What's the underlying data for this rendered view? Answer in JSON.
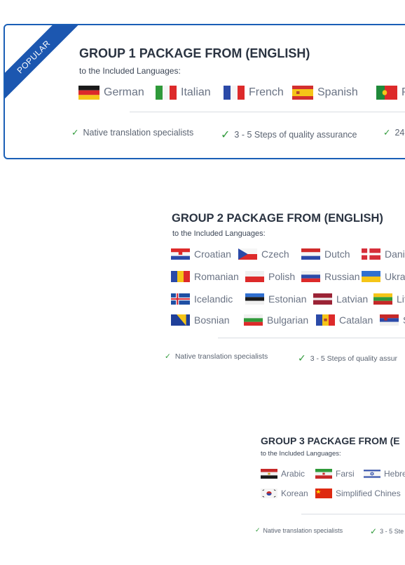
{
  "group1": {
    "badge": "POPULAR",
    "title": "GROUP 1 PACKAGE FROM (ENGLISH)",
    "subtitle": "to the Included Languages:",
    "languages": [
      "German",
      "Italian",
      "French",
      "Spanish",
      "P"
    ],
    "features": [
      "Native translation specialists",
      "3 - 5 Steps of quality assurance",
      "24"
    ]
  },
  "group2": {
    "title": "GROUP 2 PACKAGE FROM (ENGLISH)",
    "subtitle": "to the Included Languages:",
    "languages": [
      "Croatian",
      "Czech",
      "Dutch",
      "Dani",
      "Romanian",
      "Polish",
      "Russian",
      "Ukra",
      "Icelandic",
      "Estonian",
      "Latvian",
      "Lit",
      "Bosnian",
      "Bulgarian",
      "Catalan",
      "S"
    ],
    "features": [
      "Native translation specialists",
      "3 - 5 Steps of quality assur"
    ]
  },
  "group3": {
    "title": "GROUP 3 PACKAGE FROM (E",
    "subtitle": "to the Included Languages:",
    "languages": [
      "Arabic",
      "Farsi",
      "Hebre",
      "Korean",
      "Simplified Chines"
    ],
    "features": [
      "Native translation specialists",
      "3 - 5 Ste"
    ]
  },
  "colors": {
    "accent": "#1b5fb6",
    "check": "#2f9a3a"
  }
}
